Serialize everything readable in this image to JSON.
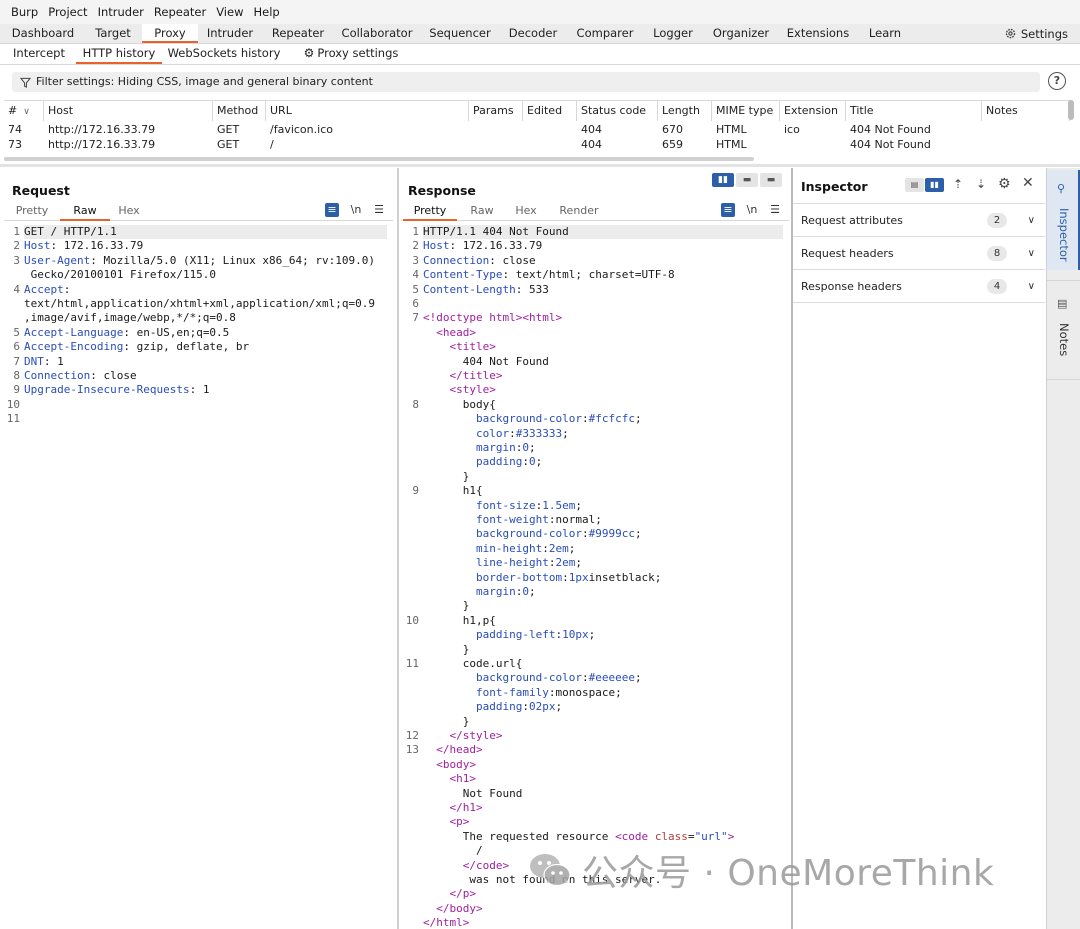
{
  "menu": [
    "Burp",
    "Project",
    "Intruder",
    "Repeater",
    "View",
    "Help"
  ],
  "top_tabs": [
    "Dashboard",
    "Target",
    "Proxy",
    "Intruder",
    "Repeater",
    "Collaborator",
    "Sequencer",
    "Decoder",
    "Comparer",
    "Logger",
    "Organizer",
    "Extensions",
    "Learn"
  ],
  "top_tab_active": "Proxy",
  "settings_label": "Settings",
  "sub_tabs": [
    "Intercept",
    "HTTP history",
    "WebSockets history",
    "Proxy settings"
  ],
  "filter_text": "Filter settings: Hiding CSS, image and general binary content",
  "help_label": "?",
  "table": {
    "columns": [
      "#",
      "Host",
      "Method",
      "URL",
      "Params",
      "Edited",
      "Status code",
      "Length",
      "MIME type",
      "Extension",
      "Title",
      "Notes"
    ],
    "rows": [
      {
        "n": "74",
        "host": "http://172.16.33.79",
        "method": "GET",
        "url": "/favicon.ico",
        "params": "",
        "edited": "",
        "status": "404",
        "length": "670",
        "mime": "HTML",
        "ext": "ico",
        "title": "404 Not Found",
        "notes": ""
      },
      {
        "n": "73",
        "host": "http://172.16.33.79",
        "method": "GET",
        "url": "/",
        "params": "",
        "edited": "",
        "status": "404",
        "length": "659",
        "mime": "HTML",
        "ext": "",
        "title": "404 Not Found",
        "notes": ""
      }
    ]
  },
  "request": {
    "title": "Request",
    "tabs": [
      "Pretty",
      "Raw",
      "Hex"
    ],
    "active_tab": "Raw",
    "newline_label": "\\n",
    "lines": [
      {
        "n": "1",
        "k": "",
        "v": "GET / HTTP/1.1"
      },
      {
        "n": "2",
        "k": "Host",
        "v": ": 172.16.33.79"
      },
      {
        "n": "3",
        "k": "User-Agent",
        "v": ": Mozilla/5.0 (X11; Linux x86_64; rv:109.0)"
      },
      {
        "n": "",
        "k": "",
        "v": " Gecko/20100101 Firefox/115.0"
      },
      {
        "n": "4",
        "k": "Accept",
        "v": ":"
      },
      {
        "n": "",
        "k": "",
        "v": "text/html,application/xhtml+xml,application/xml;q=0.9"
      },
      {
        "n": "",
        "k": "",
        "v": ",image/avif,image/webp,*/*;q=0.8"
      },
      {
        "n": "5",
        "k": "Accept-Language",
        "v": ": en-US,en;q=0.5"
      },
      {
        "n": "6",
        "k": "Accept-Encoding",
        "v": ": gzip, deflate, br"
      },
      {
        "n": "7",
        "k": "DNT",
        "v": ": 1"
      },
      {
        "n": "8",
        "k": "Connection",
        "v": ": close"
      },
      {
        "n": "9",
        "k": "Upgrade-Insecure-Requests",
        "v": ": 1"
      },
      {
        "n": "10",
        "k": "",
        "v": ""
      },
      {
        "n": "11",
        "k": "",
        "v": ""
      }
    ]
  },
  "response": {
    "title": "Response",
    "tabs": [
      "Pretty",
      "Raw",
      "Hex",
      "Render"
    ],
    "active_tab": "Pretty",
    "newline_label": "\\n",
    "lines": [
      {
        "n": "1",
        "segs": [
          [
            "p",
            "HTTP/1.1 404 Not Found"
          ]
        ]
      },
      {
        "n": "2",
        "segs": [
          [
            "k",
            "Host"
          ],
          [
            "p",
            ": 172.16.33.79"
          ]
        ]
      },
      {
        "n": "3",
        "segs": [
          [
            "k",
            "Connection"
          ],
          [
            "p",
            ": close"
          ]
        ]
      },
      {
        "n": "4",
        "segs": [
          [
            "k",
            "Content-Type"
          ],
          [
            "p",
            ": text/html; charset=UTF-8"
          ]
        ]
      },
      {
        "n": "5",
        "segs": [
          [
            "k",
            "Content-Length"
          ],
          [
            "p",
            ": 533"
          ]
        ]
      },
      {
        "n": "6",
        "segs": []
      },
      {
        "n": "7",
        "segs": [
          [
            "t",
            "<!doctype html>"
          ],
          [
            "t",
            "<html>"
          ]
        ]
      },
      {
        "n": "",
        "segs": [
          [
            "p",
            "  "
          ],
          [
            "t",
            "<head>"
          ]
        ]
      },
      {
        "n": "",
        "segs": [
          [
            "p",
            "    "
          ],
          [
            "t",
            "<title>"
          ]
        ]
      },
      {
        "n": "",
        "segs": [
          [
            "p",
            "      404 Not Found"
          ]
        ]
      },
      {
        "n": "",
        "segs": [
          [
            "p",
            "    "
          ],
          [
            "t",
            "</title>"
          ]
        ]
      },
      {
        "n": "",
        "segs": [
          [
            "p",
            "    "
          ],
          [
            "t",
            "<style>"
          ]
        ]
      },
      {
        "n": "8",
        "segs": [
          [
            "p",
            "      body{"
          ]
        ]
      },
      {
        "n": "",
        "segs": [
          [
            "p",
            "        "
          ],
          [
            "k",
            "background-color"
          ],
          [
            "p",
            ":"
          ],
          [
            "v",
            "#fcfcfc"
          ],
          [
            "p",
            ";"
          ]
        ]
      },
      {
        "n": "",
        "segs": [
          [
            "p",
            "        "
          ],
          [
            "k",
            "color"
          ],
          [
            "p",
            ":"
          ],
          [
            "v",
            "#333333"
          ],
          [
            "p",
            ";"
          ]
        ]
      },
      {
        "n": "",
        "segs": [
          [
            "p",
            "        "
          ],
          [
            "k",
            "margin"
          ],
          [
            "p",
            ":"
          ],
          [
            "v",
            "0"
          ],
          [
            "p",
            ";"
          ]
        ]
      },
      {
        "n": "",
        "segs": [
          [
            "p",
            "        "
          ],
          [
            "k",
            "padding"
          ],
          [
            "p",
            ":"
          ],
          [
            "v",
            "0"
          ],
          [
            "p",
            ";"
          ]
        ]
      },
      {
        "n": "",
        "segs": [
          [
            "p",
            "      }"
          ]
        ]
      },
      {
        "n": "9",
        "segs": [
          [
            "p",
            "      h1{"
          ]
        ]
      },
      {
        "n": "",
        "segs": [
          [
            "p",
            "        "
          ],
          [
            "k",
            "font-size"
          ],
          [
            "p",
            ":"
          ],
          [
            "v",
            "1.5em"
          ],
          [
            "p",
            ";"
          ]
        ]
      },
      {
        "n": "",
        "segs": [
          [
            "p",
            "        "
          ],
          [
            "k",
            "font-weight"
          ],
          [
            "p",
            ":normal;"
          ]
        ]
      },
      {
        "n": "",
        "segs": [
          [
            "p",
            "        "
          ],
          [
            "k",
            "background-color"
          ],
          [
            "p",
            ":"
          ],
          [
            "v",
            "#9999cc"
          ],
          [
            "p",
            ";"
          ]
        ]
      },
      {
        "n": "",
        "segs": [
          [
            "p",
            "        "
          ],
          [
            "k",
            "min-height"
          ],
          [
            "p",
            ":"
          ],
          [
            "v",
            "2em"
          ],
          [
            "p",
            ";"
          ]
        ]
      },
      {
        "n": "",
        "segs": [
          [
            "p",
            "        "
          ],
          [
            "k",
            "line-height"
          ],
          [
            "p",
            ":"
          ],
          [
            "v",
            "2em"
          ],
          [
            "p",
            ";"
          ]
        ]
      },
      {
        "n": "",
        "segs": [
          [
            "p",
            "        "
          ],
          [
            "k",
            "border-bottom"
          ],
          [
            "p",
            ":"
          ],
          [
            "v",
            "1px"
          ],
          [
            "p",
            "insetblack;"
          ]
        ]
      },
      {
        "n": "",
        "segs": [
          [
            "p",
            "        "
          ],
          [
            "k",
            "margin"
          ],
          [
            "p",
            ":"
          ],
          [
            "v",
            "0"
          ],
          [
            "p",
            ";"
          ]
        ]
      },
      {
        "n": "",
        "segs": [
          [
            "p",
            "      }"
          ]
        ]
      },
      {
        "n": "10",
        "segs": [
          [
            "p",
            "      h1,p{"
          ]
        ]
      },
      {
        "n": "",
        "segs": [
          [
            "p",
            "        "
          ],
          [
            "k",
            "padding-left"
          ],
          [
            "p",
            ":"
          ],
          [
            "v",
            "10px"
          ],
          [
            "p",
            ";"
          ]
        ]
      },
      {
        "n": "",
        "segs": [
          [
            "p",
            "      }"
          ]
        ]
      },
      {
        "n": "11",
        "segs": [
          [
            "p",
            "      code.url{"
          ]
        ]
      },
      {
        "n": "",
        "segs": [
          [
            "p",
            "        "
          ],
          [
            "k",
            "background-color"
          ],
          [
            "p",
            ":"
          ],
          [
            "v",
            "#eeeeee"
          ],
          [
            "p",
            ";"
          ]
        ]
      },
      {
        "n": "",
        "segs": [
          [
            "p",
            "        "
          ],
          [
            "k",
            "font-family"
          ],
          [
            "p",
            ":monospace;"
          ]
        ]
      },
      {
        "n": "",
        "segs": [
          [
            "p",
            "        "
          ],
          [
            "k",
            "padding"
          ],
          [
            "p",
            ":"
          ],
          [
            "v",
            "02px"
          ],
          [
            "p",
            ";"
          ]
        ]
      },
      {
        "n": "",
        "segs": [
          [
            "p",
            "      }"
          ]
        ]
      },
      {
        "n": "12",
        "segs": [
          [
            "p",
            "    "
          ],
          [
            "t",
            "</style>"
          ]
        ]
      },
      {
        "n": "13",
        "segs": [
          [
            "p",
            "  "
          ],
          [
            "t",
            "</head>"
          ]
        ]
      },
      {
        "n": "",
        "segs": [
          [
            "p",
            "  "
          ],
          [
            "t",
            "<body>"
          ]
        ]
      },
      {
        "n": "",
        "segs": [
          [
            "p",
            "    "
          ],
          [
            "t",
            "<h1>"
          ]
        ]
      },
      {
        "n": "",
        "segs": [
          [
            "p",
            "      Not Found"
          ]
        ]
      },
      {
        "n": "",
        "segs": [
          [
            "p",
            "    "
          ],
          [
            "t",
            "</h1>"
          ]
        ]
      },
      {
        "n": "",
        "segs": [
          [
            "p",
            "    "
          ],
          [
            "t",
            "<p>"
          ]
        ]
      },
      {
        "n": "",
        "segs": [
          [
            "p",
            "      The requested resource "
          ],
          [
            "t",
            "<code "
          ],
          [
            "a",
            "class"
          ],
          [
            "p",
            "="
          ],
          [
            "v",
            "\"url\""
          ],
          [
            "t",
            ">"
          ]
        ]
      },
      {
        "n": "",
        "segs": [
          [
            "p",
            "        /"
          ]
        ]
      },
      {
        "n": "",
        "segs": [
          [
            "p",
            "      "
          ],
          [
            "t",
            "</code>"
          ]
        ]
      },
      {
        "n": "",
        "segs": [
          [
            "p",
            "       was not found on this server."
          ]
        ]
      },
      {
        "n": "",
        "segs": [
          [
            "p",
            "    "
          ],
          [
            "t",
            "</p>"
          ]
        ]
      },
      {
        "n": "",
        "segs": [
          [
            "p",
            "  "
          ],
          [
            "t",
            "</body>"
          ]
        ]
      },
      {
        "n": "",
        "segs": [
          [
            "t",
            "</html>"
          ]
        ]
      }
    ]
  },
  "inspector": {
    "title": "Inspector",
    "rows": [
      {
        "label": "Request attributes",
        "count": "2"
      },
      {
        "label": "Request headers",
        "count": "8"
      },
      {
        "label": "Response headers",
        "count": "4"
      }
    ]
  },
  "sidebar_tabs": [
    "Inspector",
    "Notes"
  ],
  "watermark": {
    "text": "公众号 · OneMoreThink"
  },
  "colors": {
    "accent": "#e8632b",
    "blue": "#2d5fa8",
    "key": "#2a4db8",
    "tag": "#a020a0"
  }
}
